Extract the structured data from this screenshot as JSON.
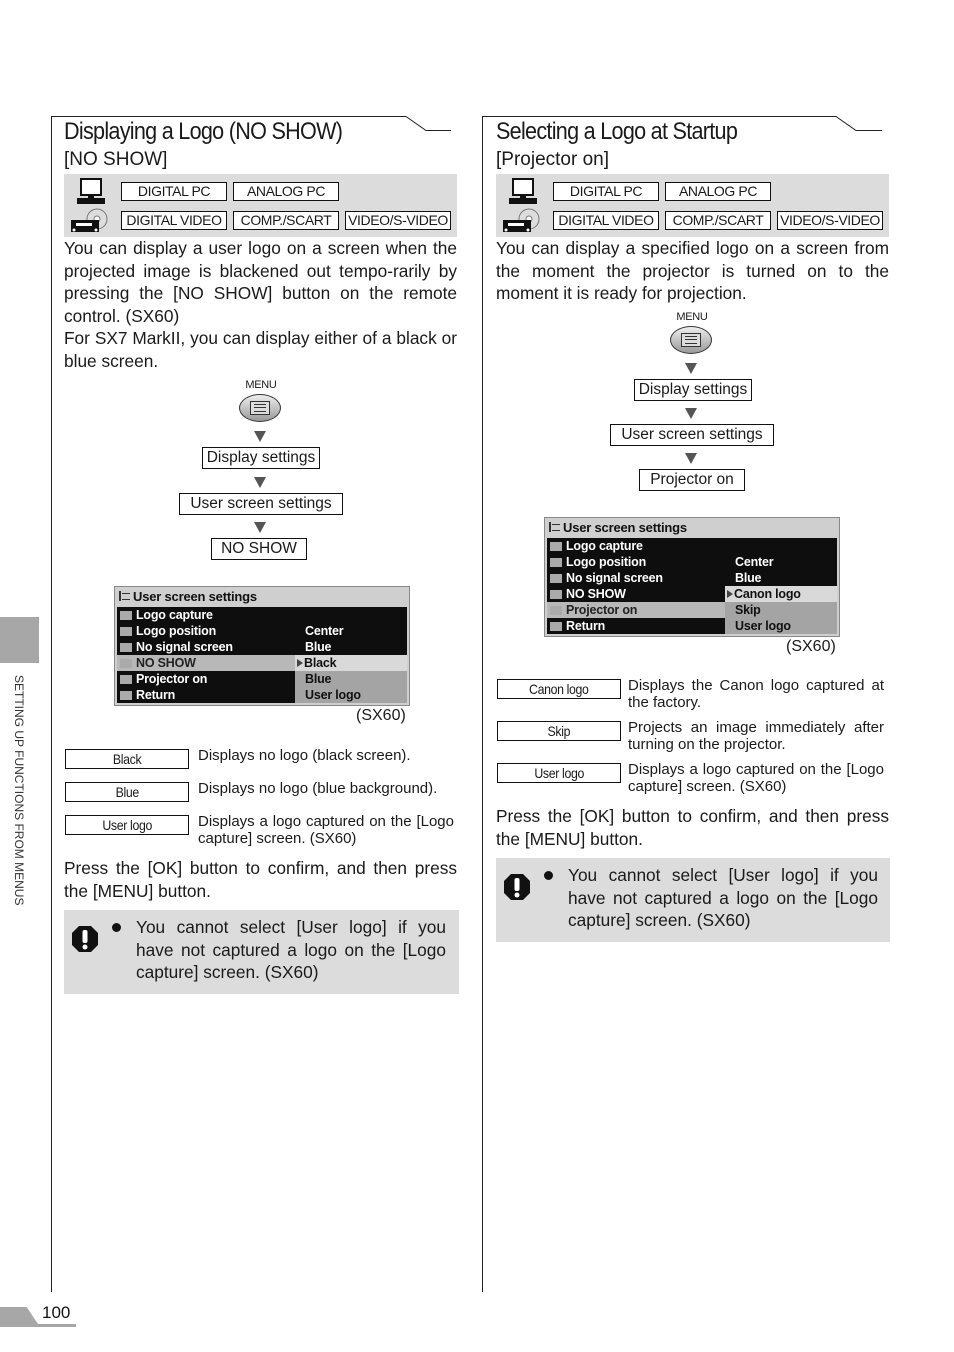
{
  "side_tab": {
    "label": "SETTING UP FUNCTIONS FROM MENUS"
  },
  "page_number": "100",
  "sections": [
    {
      "title": "Displaying a Logo (NO SHOW)",
      "subtitle": "[NO SHOW]",
      "input_sources": {
        "row1": [
          "DIGITAL PC",
          "ANALOG PC"
        ],
        "row2": [
          "DIGITAL VIDEO",
          "COMP./SCART",
          "VIDEO/S-VIDEO"
        ]
      },
      "body": "You can display a user logo on a screen when the projected image is blackened out tempo-rarily by pressing the [NO SHOW] button on the remote control. (SX60)",
      "body2": "For SX7 MarkII, you can display either of a black or blue screen.",
      "menu_flow": {
        "menu_label": "MENU",
        "steps": [
          "Display settings",
          "User screen settings",
          "NO SHOW"
        ]
      },
      "osd": {
        "title": "User screen settings",
        "rows": [
          {
            "label": "Logo capture",
            "value": ""
          },
          {
            "label": "Logo position",
            "value": "Center"
          },
          {
            "label": "No signal screen",
            "value": "Blue"
          },
          {
            "label": "NO SHOW",
            "value": "Black"
          },
          {
            "label": "Projector on",
            "value": "Blue"
          },
          {
            "label": "Return",
            "value": "User logo"
          }
        ],
        "highlighted_row": "NO SHOW",
        "selected_value": "Black",
        "caption": "(SX60)"
      },
      "options": [
        {
          "key": "Black",
          "desc": "Displays no logo (black screen)."
        },
        {
          "key": "Blue",
          "desc": "Displays no logo (blue background)."
        },
        {
          "key": "User logo",
          "desc": "Displays a logo captured on the [Logo capture] screen. (SX60)"
        }
      ],
      "confirm_text": "Press the [OK] button to confirm, and then press the [MENU] button.",
      "caution": "You cannot select [User logo] if you have not captured a logo on the [Logo capture] screen. (SX60)"
    },
    {
      "title": "Selecting a Logo at Startup",
      "subtitle": "[Projector on]",
      "input_sources": {
        "row1": [
          "DIGITAL PC",
          "ANALOG PC"
        ],
        "row2": [
          "DIGITAL VIDEO",
          "COMP./SCART",
          "VIDEO/S-VIDEO"
        ]
      },
      "body": "You can display a specified logo on a screen from the moment the projector is turned on to the moment it is ready for projection.",
      "menu_flow": {
        "menu_label": "MENU",
        "steps": [
          "Display settings",
          "User screen settings",
          "Projector on"
        ]
      },
      "osd": {
        "title": "User screen settings",
        "rows": [
          {
            "label": "Logo capture",
            "value": ""
          },
          {
            "label": "Logo position",
            "value": "Center"
          },
          {
            "label": "No signal screen",
            "value": "Blue"
          },
          {
            "label": "NO SHOW",
            "value": "Canon logo"
          },
          {
            "label": "Projector on",
            "value": "Skip"
          },
          {
            "label": "Return",
            "value": "User logo"
          }
        ],
        "highlighted_row": "Projector on",
        "selected_value": "Canon logo",
        "caption": "(SX60)"
      },
      "options": [
        {
          "key": "Canon logo",
          "desc": "Displays the Canon logo captured at the factory."
        },
        {
          "key": "Skip",
          "desc": "Projects an image immediately after turning on the projector."
        },
        {
          "key": "User logo",
          "desc": "Displays a logo captured on the [Logo capture] screen. (SX60)"
        }
      ],
      "confirm_text": "Press the [OK] button to confirm, and then press the [MENU] button.",
      "caution": "You cannot select [User logo] if you have not captured a logo on the [Logo capture] screen. (SX60)"
    }
  ]
}
